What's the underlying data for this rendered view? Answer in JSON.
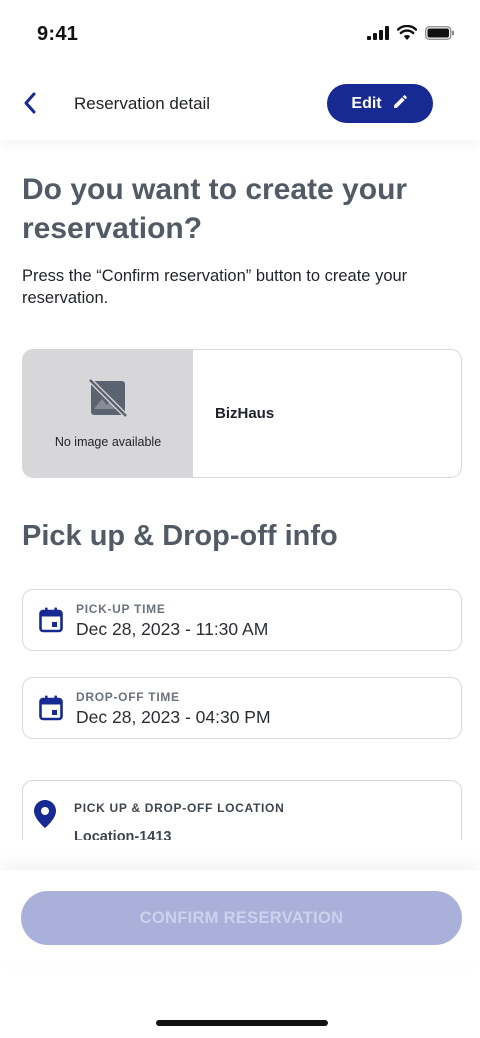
{
  "status_bar": {
    "time": "9:41"
  },
  "header": {
    "title": "Reservation detail",
    "edit_label": "Edit"
  },
  "main": {
    "title": "Do you want to create your reservation?",
    "description": "Press the “Confirm reservation” button to create your reservation."
  },
  "vendor": {
    "no_image_text": "No image available",
    "name": "BizHaus"
  },
  "info": {
    "section_title": "Pick up & Drop-off info",
    "pickup": {
      "label": "PICK-UP TIME",
      "value": "Dec 28, 2023 - 11:30 AM"
    },
    "dropoff": {
      "label": "DROP-OFF TIME",
      "value": "Dec 28, 2023 - 04:30 PM"
    },
    "location": {
      "label": "PICK UP & DROP-OFF LOCATION",
      "value": "Location-1413"
    }
  },
  "footer": {
    "confirm_label": "CONFIRM RESERVATION",
    "confirm_disabled": true
  },
  "colors": {
    "primary": "#172a94",
    "disabled_button": "#a9b0da",
    "heading": "#525a66"
  }
}
